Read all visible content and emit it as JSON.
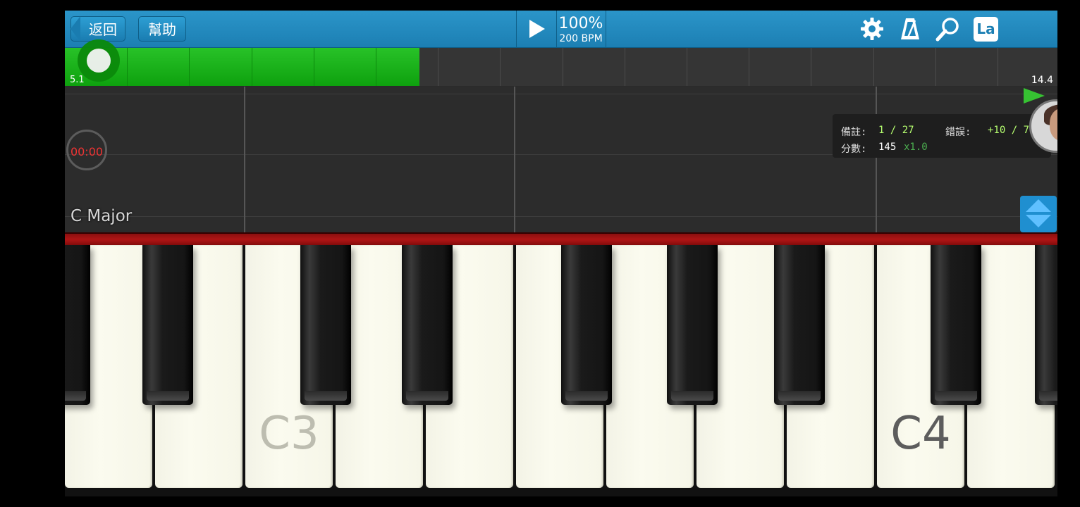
{
  "toolbar": {
    "back_label": "返回",
    "help_label": "幫助",
    "tempo_percent": "100%",
    "tempo_bpm": "200 BPM",
    "notation_label": "La"
  },
  "progress": {
    "start_marker": "5.1",
    "end_marker": "14.4",
    "played_fraction": 0.357
  },
  "score": {
    "timer": "00:00",
    "key_signature": "C Major"
  },
  "stats": {
    "notes_label": "備註:",
    "notes_value": "1 / 27",
    "errors_label": "錯誤:",
    "errors_value": "+10 / 7",
    "score_label": "分數:",
    "score_value": "145",
    "multiplier": "x1.0"
  },
  "keyboard": {
    "c3_label": "C3",
    "c4_label": "C4"
  },
  "colors": {
    "toolbar": "#1c7fb3",
    "progress_fill": "#0ea10e",
    "timer_text": "#e33333",
    "stats_value": "#b6ff70",
    "multiplier": "#4caf50",
    "felt": "#b01515"
  },
  "icons": [
    "back-arrow-icon",
    "play-icon",
    "gear-icon",
    "metronome-icon",
    "search-icon",
    "la-notation-icon",
    "flag-icon",
    "avatar-icon",
    "scroll-arrows-icon"
  ]
}
